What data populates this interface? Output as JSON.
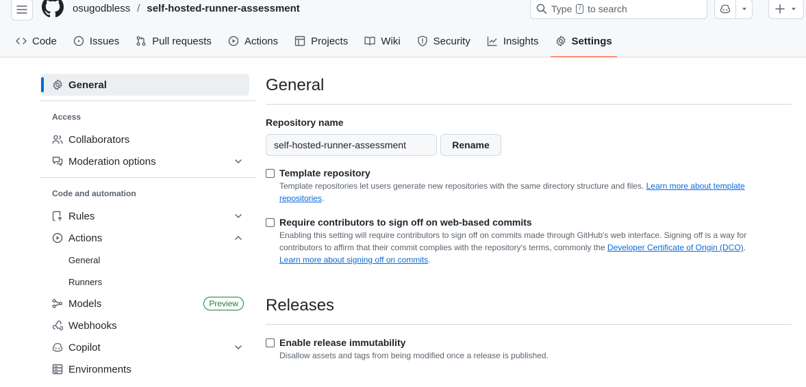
{
  "header": {
    "owner": "osugodbless",
    "separator": "/",
    "repo": "self-hosted-runner-assessment",
    "search_prefix": "Type",
    "search_key": "/",
    "search_suffix": "to search"
  },
  "nav": {
    "code": "Code",
    "issues": "Issues",
    "pulls": "Pull requests",
    "actions": "Actions",
    "projects": "Projects",
    "wiki": "Wiki",
    "security": "Security",
    "insights": "Insights",
    "settings": "Settings"
  },
  "sidebar": {
    "general": "General",
    "access_heading": "Access",
    "collaborators": "Collaborators",
    "moderation": "Moderation options",
    "code_heading": "Code and automation",
    "rules": "Rules",
    "actions": "Actions",
    "actions_general": "General",
    "actions_runners": "Runners",
    "models": "Models",
    "preview_badge": "Preview",
    "webhooks": "Webhooks",
    "copilot": "Copilot",
    "environments": "Environments"
  },
  "main": {
    "title": "General",
    "repo_name_label": "Repository name",
    "repo_name_value": "self-hosted-runner-assessment",
    "rename_button": "Rename",
    "template_title": "Template repository",
    "template_desc": "Template repositories let users generate new repositories with the same directory structure and files.",
    "template_link": "Learn more about template repositories",
    "signoff_title": "Require contributors to sign off on web-based commits",
    "signoff_desc": "Enabling this setting will require contributors to sign off on commits made through GitHub's web interface. Signing off is a way for contributors to affirm that their commit complies with the repository's terms, commonly the",
    "signoff_dco_link": "Developer Certificate of Origin (DCO)",
    "signoff_link": "Learn more about signing off on commits",
    "releases_title": "Releases",
    "immutability_title": "Enable release immutability",
    "immutability_desc": "Disallow assets and tags from being modified once a release is published."
  }
}
